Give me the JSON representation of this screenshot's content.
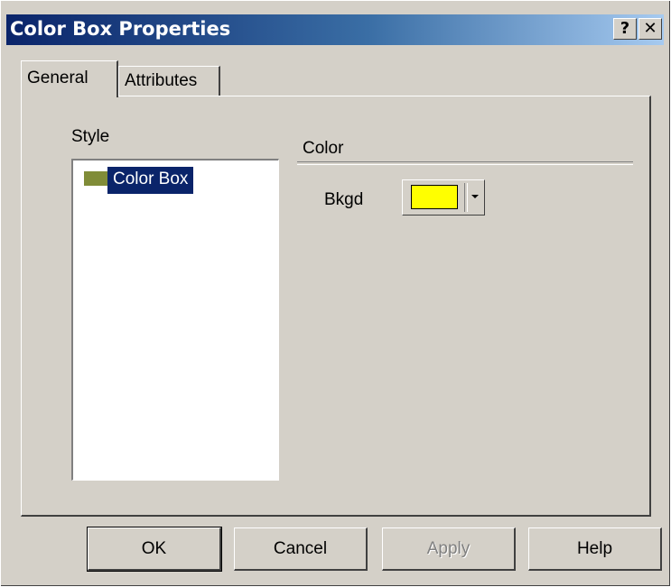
{
  "window": {
    "title": "Color Box Properties",
    "help_glyph": "?",
    "close_glyph": "✕"
  },
  "tabs": [
    {
      "label": "General",
      "selected": true
    },
    {
      "label": "Attributes",
      "selected": false
    }
  ],
  "style": {
    "label": "Style",
    "items": [
      {
        "label": "Color Box",
        "swatch_color": "#808c38",
        "selected": true
      }
    ]
  },
  "color_group": {
    "label": "Color",
    "bkgd_label": "Bkgd",
    "bkgd_value": "#ffff00"
  },
  "buttons": {
    "ok": "OK",
    "cancel": "Cancel",
    "apply": "Apply",
    "help": "Help"
  }
}
